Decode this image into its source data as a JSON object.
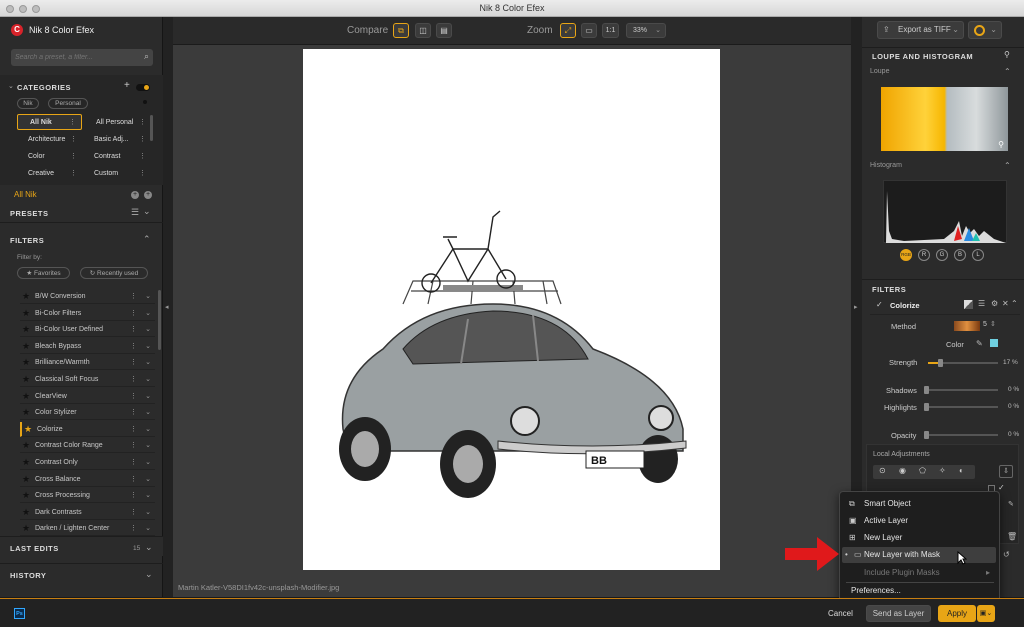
{
  "app": {
    "title": "Nik 8 Color Efex"
  },
  "left": {
    "app_name": "Nik 8 Color Efex",
    "search": {
      "placeholder": "Search a preset, a filter..."
    },
    "categories": {
      "title": "CATEGORIES",
      "chips": [
        "Nik",
        "Personal"
      ],
      "items": [
        {
          "label": "All Nik",
          "selected": true
        },
        {
          "label": "All Personal"
        },
        {
          "label": "Architecture"
        },
        {
          "label": "Basic Adj..."
        },
        {
          "label": "Color"
        },
        {
          "label": "Contrast"
        },
        {
          "label": "Creative"
        },
        {
          "label": "Custom"
        }
      ]
    },
    "current_category": "All Nik",
    "presets": {
      "title": "PRESETS"
    },
    "filters": {
      "title": "FILTERS",
      "filter_by": "Filter by:",
      "favorites": "Favorites",
      "recently_used": "Recently used",
      "items": [
        {
          "label": "B/W Conversion"
        },
        {
          "label": "Bi-Color Filters"
        },
        {
          "label": "Bi-Color User Defined"
        },
        {
          "label": "Bleach Bypass"
        },
        {
          "label": "Brilliance/Warmth"
        },
        {
          "label": "Classical Soft Focus"
        },
        {
          "label": "ClearView"
        },
        {
          "label": "Color Stylizer"
        },
        {
          "label": "Colorize",
          "active": true
        },
        {
          "label": "Contrast Color Range"
        },
        {
          "label": "Contrast Only"
        },
        {
          "label": "Cross Balance"
        },
        {
          "label": "Cross Processing"
        },
        {
          "label": "Dark Contrasts"
        },
        {
          "label": "Darken / Lighten Center"
        }
      ]
    },
    "last_edits": {
      "title": "LAST EDITS",
      "count": "15"
    },
    "history": {
      "title": "HISTORY"
    }
  },
  "toolbar": {
    "compare_label": "Compare",
    "zoom_label": "Zoom",
    "zoom_one": "1:1",
    "zoom_value": "33%"
  },
  "canvas": {
    "plate_text": "BB",
    "filename": "Martin Katler-V58DI1fv42c-unsplash-Modifier.jpg"
  },
  "right": {
    "export_label": "Export as TIFF",
    "loupe_histogram": {
      "title": "LOUPE AND HISTOGRAM",
      "loupe": "Loupe",
      "histogram": "Histogram",
      "channels": [
        "RGB",
        "R",
        "G",
        "B",
        "L"
      ]
    },
    "filters": {
      "title": "FILTERS",
      "filter_name": "Colorize",
      "method_label": "Method",
      "method_value": "5",
      "color_label": "Color",
      "strength": {
        "label": "Strength",
        "value": "17 %",
        "level": 0.17
      },
      "shadows": {
        "label": "Shadows",
        "value": "0 %",
        "level": 0
      },
      "highlights": {
        "label": "Highlights",
        "value": "0 %",
        "level": 0
      },
      "opacity": {
        "label": "Opacity",
        "value": "0 %",
        "level": 0
      },
      "local_adjustments": "Local Adjustments"
    }
  },
  "menu": {
    "items": [
      {
        "label": "Smart Object",
        "icon": "smart-object-icon"
      },
      {
        "label": "Active Layer",
        "icon": "active-layer-icon"
      },
      {
        "label": "New Layer",
        "icon": "new-layer-icon"
      },
      {
        "label": "New Layer with Mask",
        "icon": "new-layer-mask-icon",
        "selected": true
      },
      {
        "label": "Include Plugin Masks",
        "disabled": true
      },
      {
        "label": "Preferences..."
      }
    ]
  },
  "bottom": {
    "ps": "Ps",
    "cancel": "Cancel",
    "send_as_layer": "Send as Layer",
    "apply": "Apply"
  },
  "colors": {
    "accent": "#e8a516",
    "panel": "#2b2b2b",
    "swatch": "#6fd0e0",
    "arrow": "#e0191b"
  }
}
